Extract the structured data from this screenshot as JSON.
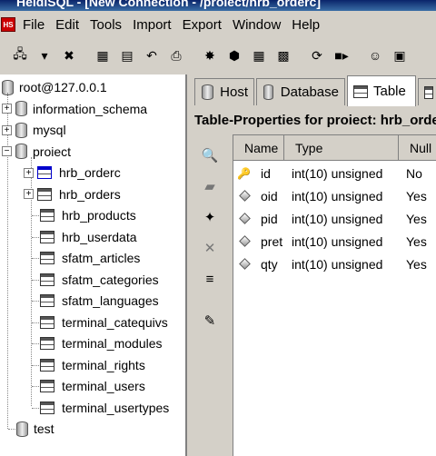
{
  "window": {
    "title": "HeidiSQL - [New Connection - /proiect/hrb_orderc]"
  },
  "menubar": {
    "app_icon": "HS",
    "items": [
      "File",
      "Edit",
      "Tools",
      "Import",
      "Export",
      "Window",
      "Help"
    ]
  },
  "toolbar": {
    "buttons": [
      {
        "icon": "connect-icon",
        "glyph": "🖧"
      },
      {
        "icon": "dropdown-arrow-icon",
        "glyph": "▾"
      },
      {
        "icon": "disconnect-icon",
        "glyph": "✖"
      },
      {
        "icon": "copy-icon",
        "glyph": "▦"
      },
      {
        "icon": "paste-icon",
        "glyph": "▤"
      },
      {
        "icon": "undo-icon",
        "glyph": "↶"
      },
      {
        "icon": "print-icon",
        "glyph": "⎙"
      },
      {
        "icon": "create-database-icon",
        "glyph": "✸"
      },
      {
        "icon": "drop-database-icon",
        "glyph": "⬢"
      },
      {
        "icon": "create-table-icon",
        "glyph": "▦"
      },
      {
        "icon": "drop-table-icon",
        "glyph": "▩"
      },
      {
        "icon": "refresh-icon",
        "glyph": "⟳"
      },
      {
        "icon": "execute-icon",
        "glyph": "■▸"
      },
      {
        "icon": "user-manager-icon",
        "glyph": "☺"
      },
      {
        "icon": "preferences-icon",
        "glyph": "▣"
      }
    ]
  },
  "tree": {
    "root": "root@127.0.0.1",
    "databases": [
      {
        "name": "information_schema",
        "expander": "+"
      },
      {
        "name": "mysql",
        "expander": "+"
      },
      {
        "name": "proiect",
        "expander": "−"
      }
    ],
    "tables": [
      {
        "name": "hrb_orderc",
        "expander": "+",
        "selected": true
      },
      {
        "name": "hrb_orders",
        "expander": "+"
      },
      {
        "name": "hrb_products"
      },
      {
        "name": "hrb_userdata"
      },
      {
        "name": "sfatm_articles"
      },
      {
        "name": "sfatm_categories"
      },
      {
        "name": "sfatm_languages"
      },
      {
        "name": "terminal_catequivs"
      },
      {
        "name": "terminal_modules"
      },
      {
        "name": "terminal_rights"
      },
      {
        "name": "terminal_users"
      },
      {
        "name": "terminal_usertypes"
      }
    ],
    "last_database": "test"
  },
  "tabs": [
    {
      "label": "Host",
      "icon": "host-icon"
    },
    {
      "label": "Database",
      "icon": "database-icon"
    },
    {
      "label": "Table",
      "icon": "table-icon",
      "active": true
    }
  ],
  "content": {
    "title": "Table-Properties for proiect: hrb_orderc",
    "side_tools": [
      "view-data-icon",
      "edit-field-icon",
      "add-field-icon",
      "drop-field-icon",
      "index-icon",
      "sql-edit-icon"
    ],
    "columns": [
      "Name",
      "Type",
      "Null"
    ],
    "fields": [
      {
        "name": "id",
        "type": "int(10) unsigned",
        "null": "No",
        "key": true
      },
      {
        "name": "oid",
        "type": "int(10) unsigned",
        "null": "Yes"
      },
      {
        "name": "pid",
        "type": "int(10) unsigned",
        "null": "Yes"
      },
      {
        "name": "pret",
        "type": "int(10) unsigned",
        "null": "Yes"
      },
      {
        "name": "qty",
        "type": "int(10) unsigned",
        "null": "Yes"
      }
    ]
  },
  "colors": {
    "selection": "#0000c0",
    "titlebar": "#0a246a"
  }
}
